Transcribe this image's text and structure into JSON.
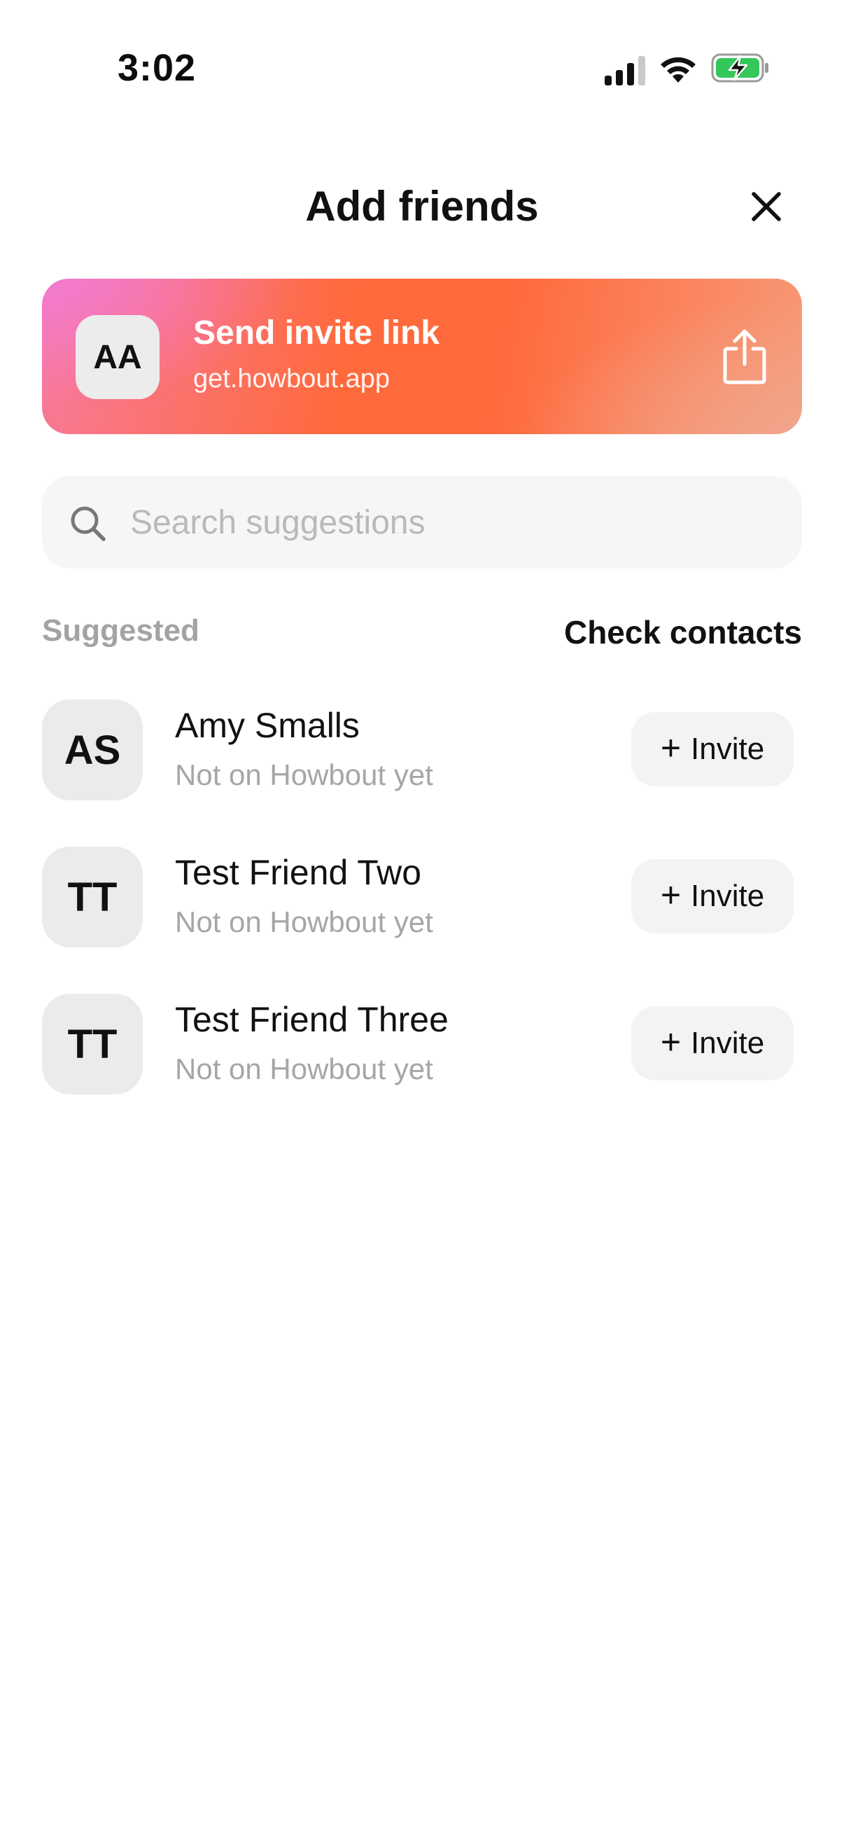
{
  "status_bar": {
    "time": "3:02",
    "icons": [
      "signal-icon",
      "wifi-icon",
      "battery-charging-icon"
    ],
    "battery_color": "#34c759"
  },
  "header": {
    "title": "Add friends",
    "close_icon": "close-icon"
  },
  "invite_banner": {
    "avatar_initials": "AA",
    "title": "Send invite link",
    "url": "get.howbout.app",
    "icon": "share-icon",
    "colors": [
      "#f37ad6",
      "#ff6a3d",
      "#f0a58c"
    ]
  },
  "search": {
    "placeholder": "Search suggestions",
    "value": "",
    "icon": "search-icon"
  },
  "section": {
    "title": "Suggested",
    "action_label": "Check contacts"
  },
  "friends": [
    {
      "initials": "AS",
      "name": "Amy Smalls",
      "status": "Not on Howbout yet",
      "action_plus": "+",
      "action_label": "Invite"
    },
    {
      "initials": "TT",
      "name": "Test Friend Two",
      "status": "Not on Howbout yet",
      "action_plus": "+",
      "action_label": "Invite"
    },
    {
      "initials": "TT",
      "name": "Test Friend Three",
      "status": "Not on Howbout yet",
      "action_plus": "+",
      "action_label": "Invite"
    }
  ]
}
